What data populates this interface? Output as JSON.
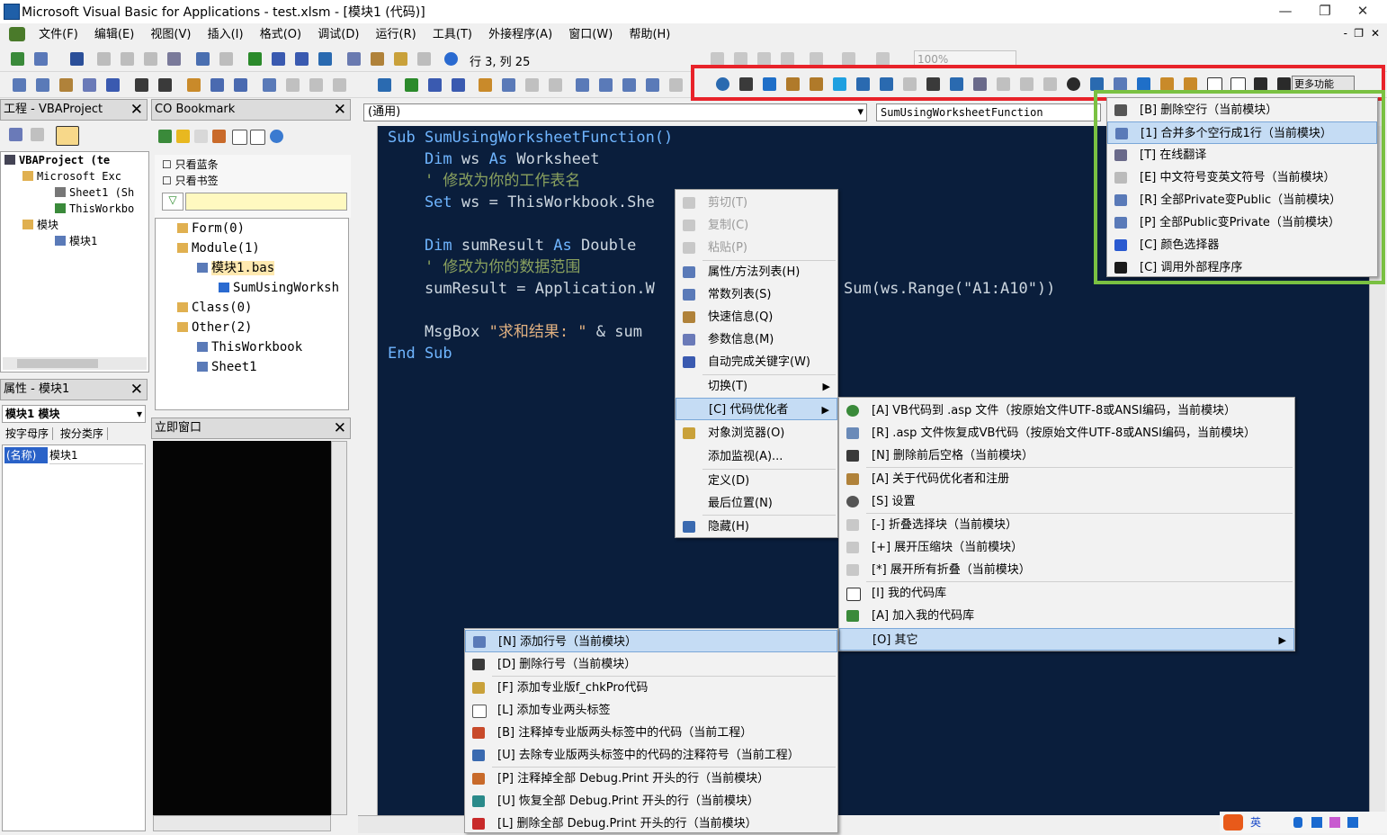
{
  "window": {
    "title": "Microsoft Visual Basic for Applications - test.xlsm - [模块1 (代码)]",
    "controls": [
      "—",
      "❐",
      "✕"
    ]
  },
  "menubar": [
    "文件(F)",
    "编辑(E)",
    "视图(V)",
    "插入(I)",
    "格式(O)",
    "调试(D)",
    "运行(R)",
    "工具(T)",
    "外接程序(A)",
    "窗口(W)",
    "帮助(H)"
  ],
  "toolbar1": {
    "position": "行 3, 列 25",
    "zoom": "100%"
  },
  "toolbar2": {
    "more_functions": "更多功能"
  },
  "project_pane": {
    "title": "工程 - VBAProject",
    "items": [
      "VBAProject (te",
      "Microsoft Exc",
      "Sheet1 (Sh",
      "ThisWorkbo",
      "模块",
      "模块1"
    ]
  },
  "bookmark_pane": {
    "title": "CO Bookmark",
    "checkboxes": [
      "只看蓝条",
      "只看书签"
    ],
    "tree": [
      "Form(0)",
      "Module(1)",
      "模块1.bas",
      "SumUsingWorksh",
      "Class(0)",
      "Other(2)",
      "ThisWorkbook",
      "Sheet1"
    ]
  },
  "properties_pane": {
    "title": "属性 - 模块1",
    "object": "模块1 模块",
    "tabs": [
      "按字母序",
      "按分类序"
    ],
    "row_name": "(名称)",
    "row_value": "模块1"
  },
  "immediate_pane": {
    "title": "立即窗口"
  },
  "code_window": {
    "object_combo": "(通用)",
    "proc_combo": "SumUsingWorksheetFunction",
    "lines": [
      {
        "t": "kw",
        "a": "Sub ",
        "b": "SumUsingWorksheetFunction()"
      },
      {
        "t": "kw",
        "a": "    Dim ",
        "b": "ws ",
        "c": "As ",
        "d": "Worksheet"
      },
      {
        "t": "cm",
        "a": "    ' 修改为你的工作表名"
      },
      {
        "t": "kw",
        "a": "    Set ",
        "b": "ws = ThisWorkbook.She"
      },
      {
        "t": "blank",
        "a": ""
      },
      {
        "t": "kw",
        "a": "    Dim ",
        "b": "sumResult ",
        "c": "As ",
        "d": "Double"
      },
      {
        "t": "cm",
        "a": "    ' 修改为你的数据范围"
      },
      {
        "t": "plain",
        "a": "    sumResult = Application.W"
      },
      {
        "t": "blank",
        "a": ""
      },
      {
        "t": "msg",
        "a": "    MsgBox ",
        "b": "\"求和结果: \"",
        "c": " & sum"
      },
      {
        "t": "kw",
        "a": "End Sub",
        "b": ""
      }
    ],
    "line8_tail": "Sum(ws.Range(\"A1:A10\"))"
  },
  "context_menu": [
    {
      "label": "剪切(T)",
      "disabled": true
    },
    {
      "label": "复制(C)",
      "disabled": true
    },
    {
      "label": "粘贴(P)",
      "disabled": true
    },
    {
      "label": "属性/方法列表(H)"
    },
    {
      "label": "常数列表(S)"
    },
    {
      "label": "快速信息(Q)"
    },
    {
      "label": "参数信息(M)"
    },
    {
      "label": "自动完成关键字(W)"
    },
    {
      "label": "切换(T)"
    },
    {
      "label": "[C] 代码优化者"
    },
    {
      "label": "对象浏览器(O)"
    },
    {
      "label": "添加监视(A)..."
    },
    {
      "label": "定义(D)"
    },
    {
      "label": "最后位置(N)"
    },
    {
      "label": "隐藏(H)"
    }
  ],
  "optimizer_menu": [
    "[A] VB代码到 .asp 文件（按原始文件UTF-8或ANSI编码，当前模块）",
    "[R] .asp 文件恢复成VB代码（按原始文件UTF-8或ANSI编码，当前模块）",
    "[N] 删除前后空格（当前模块）",
    "[A] 关于代码优化者和注册",
    "[S] 设置",
    "[-] 折叠选择块（当前模块）",
    "[+] 展开压缩块（当前模块）",
    "[*] 展开所有折叠（当前模块）",
    "[I] 我的代码库",
    "[A] 加入我的代码库",
    "[O] 其它"
  ],
  "other_menu": [
    "[N] 添加行号（当前模块）",
    "[D] 删除行号（当前模块）",
    "[F] 添加专业版f_chkPro代码",
    "[L] 添加专业两头标签",
    "[B] 注释掉专业版两头标签中的代码（当前工程）",
    "[U] 去除专业版两头标签中的代码的注释符号（当前工程）",
    "[P] 注释掉全部 Debug.Print 开头的行（当前模块）",
    "[U] 恢复全部 Debug.Print 开头的行（当前模块）",
    "[L] 删除全部 Debug.Print 开头的行（当前模块）"
  ],
  "more_menu": [
    "[B] 删除空行（当前模块）",
    "[1] 合并多个空行成1行（当前模块）",
    "[T] 在线翻译",
    "[E] 中文符号变英文符号（当前模块）",
    "[R] 全部Private变Public（当前模块）",
    "[P] 全部Public变Private（当前模块）",
    "[C] 颜色选择器",
    "[C] 调用外部程序序"
  ],
  "colors": {
    "highlight_red": "#e8232a",
    "highlight_green": "#7ac142",
    "code_bg": "#0a1e3c",
    "menu_hl": "#c5dcf4"
  },
  "tray": {
    "ime": "英"
  }
}
